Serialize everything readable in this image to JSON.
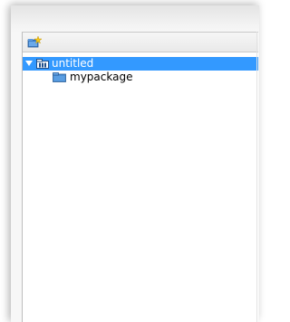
{
  "toolbar": {
    "buttons": [
      {
        "icon": "new-package-icon"
      }
    ]
  },
  "tree": {
    "root": {
      "label": "untitled",
      "icon": "package-icon",
      "expanded": true,
      "selected": true,
      "children": [
        {
          "label": "mypackage",
          "icon": "folder-icon"
        }
      ]
    }
  },
  "colors": {
    "selection": "#3399ff",
    "folder": "#4a8fd6"
  }
}
